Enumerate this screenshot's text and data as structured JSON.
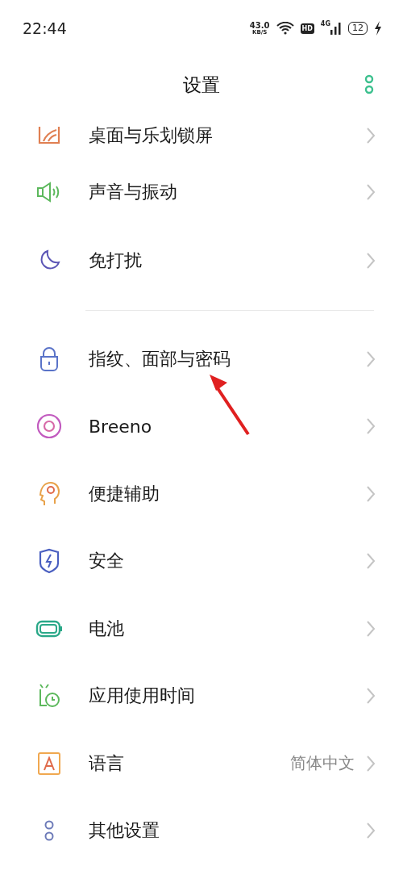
{
  "status_bar": {
    "time": "22:44",
    "speed": "43.0",
    "speed_unit": "KB/S",
    "hd_badge": "HD",
    "network": "4G",
    "battery": "12"
  },
  "header": {
    "title": "设置"
  },
  "groups": [
    {
      "items": [
        {
          "label": "桌面与乐划锁屏"
        },
        {
          "label": "声音与振动"
        },
        {
          "label": "免打扰"
        }
      ]
    },
    {
      "items": [
        {
          "label": "指纹、面部与密码"
        },
        {
          "label": "Breeno"
        },
        {
          "label": "便捷辅助"
        },
        {
          "label": "安全"
        },
        {
          "label": "电池"
        },
        {
          "label": "应用使用时间"
        },
        {
          "label": "语言",
          "value": "简体中文"
        },
        {
          "label": "其他设置"
        }
      ]
    }
  ]
}
